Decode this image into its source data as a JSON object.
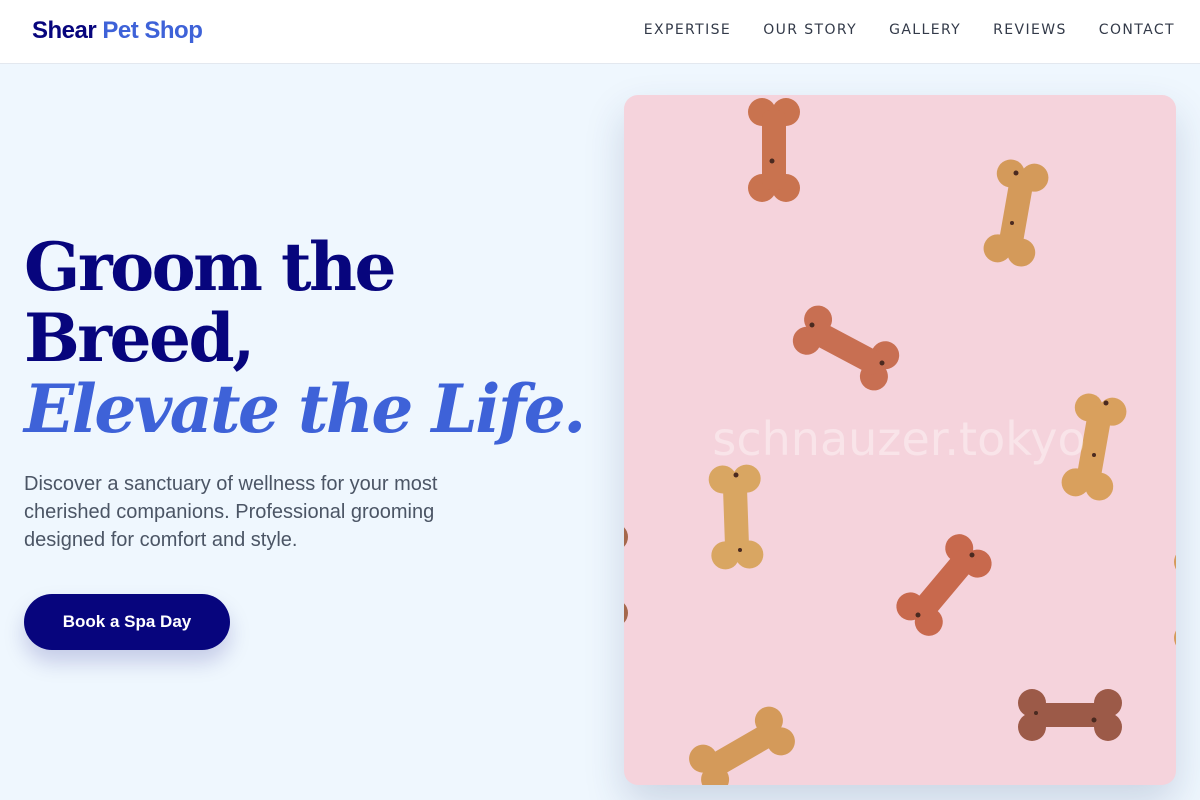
{
  "brand": {
    "name_part1": "Shear",
    "name_part2": "Pet Shop"
  },
  "nav": {
    "links": [
      "EXPERTISE",
      "OUR STORY",
      "GALLERY",
      "REVIEWS",
      "CONTACT"
    ]
  },
  "hero": {
    "title_line1": "Groom the",
    "title_line2": "Breed,",
    "title_emphasis": "Elevate the Life.",
    "description": "Discover a sanctuary of wellness for your most cherished companions. Professional grooming designed for comfort and style.",
    "cta_label": "Book a Spa Day"
  },
  "image": {
    "watermark": "schnauzer.tokyo"
  },
  "colors": {
    "navy": "#07057d",
    "accent": "#3e62d8",
    "page_bg": "#eff7fe",
    "photo_bg": "#f5d3dc"
  }
}
